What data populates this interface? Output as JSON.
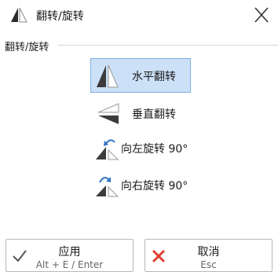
{
  "window": {
    "title": "翻转/旋转"
  },
  "section": {
    "label": "翻转/旋转"
  },
  "options": [
    {
      "label": "水平翻转",
      "icon": "flip-horizontal-icon",
      "selected": true
    },
    {
      "label": "垂直翻转",
      "icon": "flip-vertical-icon",
      "selected": false
    },
    {
      "label": "向左旋转 90°",
      "icon": "rotate-left-icon",
      "selected": false
    },
    {
      "label": "向右旋转 90°",
      "icon": "rotate-right-icon",
      "selected": false
    }
  ],
  "buttons": {
    "apply": {
      "label": "应用",
      "shortcut": "Alt + E / Enter",
      "icon": "checkmark-icon"
    },
    "cancel": {
      "label": "取消",
      "shortcut": "Esc",
      "icon": "x-icon",
      "icon_color": "#e0402f"
    }
  },
  "colors": {
    "selection_bg": "#cce0f7",
    "selection_border": "#7eaedf",
    "rotate_arrow": "#2f74c4"
  }
}
